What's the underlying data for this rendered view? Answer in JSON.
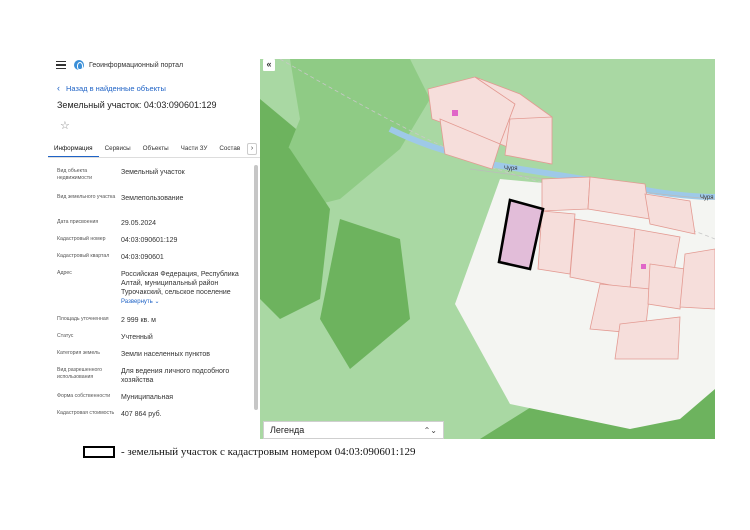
{
  "app": {
    "portal_title": "Геоинформационный портал",
    "back_label": "Назад в найденные объекты",
    "object_title": "Земельный участок: 04:03:090601:129"
  },
  "tabs": [
    {
      "label": "Информация",
      "active": true
    },
    {
      "label": "Сервисы"
    },
    {
      "label": "Объекты"
    },
    {
      "label": "Части ЗУ"
    },
    {
      "label": "Состав"
    }
  ],
  "tab_more": "›",
  "properties": [
    {
      "label": "Вид объекта недвижимости",
      "value": "Земельный участок"
    },
    {
      "label": "Вид земельного участка",
      "value": "Землепользование"
    },
    {
      "label": "Дата присвоения",
      "value": "29.05.2024"
    },
    {
      "label": "Кадастровый номер",
      "value": "04:03:090601:129"
    },
    {
      "label": "Кадастровый квартал",
      "value": "04:03:090601"
    },
    {
      "label": "Адрес",
      "value": "Российская Федерация, Республика Алтай, муниципальный район Турочакский, сельское поселение",
      "expand": "Развернуть ⌄"
    },
    {
      "label": "Площадь уточненная",
      "value": "2 999 кв. м"
    },
    {
      "label": "Статус",
      "value": "Учтенный"
    },
    {
      "label": "Категория земель",
      "value": "Земли населенных пунктов"
    },
    {
      "label": "Вид разрешенного использования",
      "value": "Для ведения личного подсобного хозяйства"
    },
    {
      "label": "Форма собственности",
      "value": "Муниципальная"
    },
    {
      "label": "Кадастровая стоимость",
      "value": "407 864 руб."
    }
  ],
  "map": {
    "collapse_icon": "«",
    "legend_label": "Легенда",
    "legend_toggle": "⌃⌄",
    "road_label_1": "Чуря",
    "road_label_2": "Чуря",
    "colors": {
      "forest": "#6db35e",
      "meadow": "#a9d8a3",
      "open": "#f4f5f2",
      "parcel": "#f6dedb",
      "parcel_stroke": "#e39a92",
      "selected": "#e2bdd9",
      "river": "#9ec9e8"
    }
  },
  "caption": {
    "text": "- земельный участок с кадастровым номером 04:03:090601:129"
  }
}
